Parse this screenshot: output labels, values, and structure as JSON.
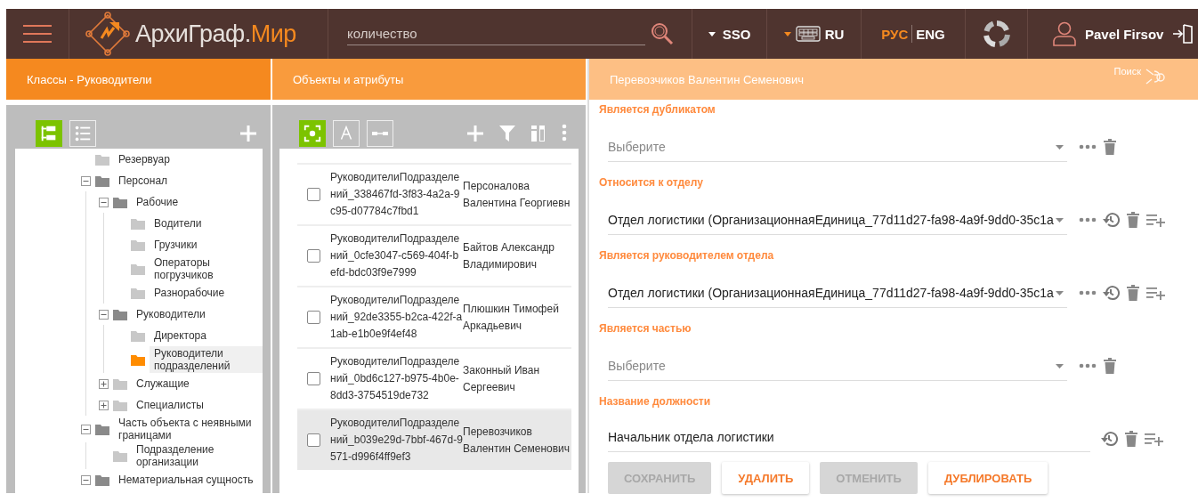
{
  "header": {
    "logo_main": "АрхиГраф.",
    "logo_accent": "Мир",
    "search": {
      "value": "количество"
    },
    "sso": "SSO",
    "keyboard": "RU",
    "languages": [
      {
        "label": "РУС",
        "selected": true
      },
      {
        "label": "ENG",
        "selected": false
      }
    ],
    "user": "Pavel Firsov"
  },
  "classes_panel": {
    "title": "Классы - Руководители",
    "view_buttons": [
      {
        "kind": "tree",
        "selected": true
      },
      {
        "kind": "list",
        "selected": false
      }
    ],
    "tree": [
      {
        "label": "Резервуар",
        "selected": false
      },
      {
        "label": "Персонал",
        "expanded": true,
        "selected": false,
        "children": [
          {
            "label": "Рабочие",
            "expanded": true,
            "selected": false,
            "children": [
              {
                "label": "Водители",
                "selected": false
              },
              {
                "label": "Грузчики",
                "selected": false
              },
              {
                "label": "Операторы погрузчиков",
                "selected": false
              },
              {
                "label": "Разнорабочие",
                "selected": false
              }
            ]
          },
          {
            "label": "Руководители",
            "expanded": true,
            "selected": false,
            "children": [
              {
                "label": "Директора",
                "selected": false
              },
              {
                "label": "Руководители подразделений",
                "selected": true
              }
            ]
          },
          {
            "label": "Служащие",
            "expanded": false,
            "selected": false
          },
          {
            "label": "Специалисты",
            "expanded": false,
            "selected": false
          }
        ]
      },
      {
        "label": "Часть объекта с неявными границами",
        "expanded": true,
        "selected": false,
        "children": [
          {
            "label": "Подразделение организации",
            "selected": false
          }
        ]
      },
      {
        "label": "Нематериальная сущность",
        "expanded": true,
        "selected": false
      }
    ]
  },
  "objects_panel": {
    "title": "Объекты и атрибуты",
    "view_buttons": [
      {
        "kind": "object",
        "selected": true
      },
      {
        "kind": "text",
        "selected": false
      },
      {
        "kind": "link",
        "selected": false
      }
    ],
    "rows": [
      {
        "id": "РуководителиПодразделений_338467fd-3f83-4a2a-9c95-d07784c7fbd1",
        "name": "Персоналова Валентина Георгиевн",
        "checked": false,
        "selected": false
      },
      {
        "id": "РуководителиПодразделений_0cfe3047-c569-404f-befd-bdc03f9e7999",
        "name": "Байтов Александр Владимирович",
        "checked": false,
        "selected": false
      },
      {
        "id": "РуководителиПодразделений_92de3355-b2ca-422f-a1ab-e1b0e9f4ef48",
        "name": "Плюшкин Тимофей Аркадьевич",
        "checked": false,
        "selected": false
      },
      {
        "id": "РуководителиПодразделений_0bd6c127-b975-4b0e-8dd3-3754519de732",
        "name": "Законный Иван Сергеевич",
        "checked": false,
        "selected": false
      },
      {
        "id": "РуководителиПодразделений_b039e29d-7bbf-467d-9571-d996f4ff9ef3",
        "name": "Перевозчиков Валентин Семенович",
        "checked": false,
        "selected": true
      }
    ]
  },
  "details_panel": {
    "title": "Перевозчиков Валентин Семенович",
    "search_label": "Поиск",
    "fields": [
      {
        "label": "Является дубликатом",
        "kind": "select",
        "placeholder": "Выберите",
        "actions": [
          {
            "kind": "more"
          },
          {
            "kind": "delete"
          }
        ]
      },
      {
        "label": "Относится к отделу",
        "kind": "select",
        "value": "Отдел логистики (ОрганизационнаяЕдиница_77d11d27-fa98-4a9f-9dd0-35c1a",
        "actions": [
          {
            "kind": "more"
          },
          {
            "kind": "history"
          },
          {
            "kind": "delete"
          },
          {
            "kind": "add"
          }
        ]
      },
      {
        "label": "Является руководителем отдела",
        "kind": "select",
        "value": "Отдел логистики (ОрганизационнаяЕдиница_77d11d27-fa98-4a9f-9dd0-35c1a",
        "actions": [
          {
            "kind": "more"
          },
          {
            "kind": "history"
          },
          {
            "kind": "delete"
          },
          {
            "kind": "add"
          }
        ]
      },
      {
        "label": "Является частью",
        "kind": "select",
        "placeholder": "Выберите",
        "actions": [
          {
            "kind": "more"
          },
          {
            "kind": "delete"
          }
        ]
      },
      {
        "label": "Название должности",
        "kind": "text",
        "value": "Начальник отдела логистики",
        "actions": [
          {
            "kind": "history"
          },
          {
            "kind": "delete"
          },
          {
            "kind": "add"
          }
        ]
      }
    ],
    "buttons": [
      {
        "label": "СОХРАНИТЬ",
        "disabled": true
      },
      {
        "label": "УДАЛИТЬ",
        "disabled": false
      },
      {
        "label": "ОТМЕНИТЬ",
        "disabled": true
      },
      {
        "label": "ДУБЛИРОВАТЬ",
        "disabled": false
      }
    ]
  }
}
